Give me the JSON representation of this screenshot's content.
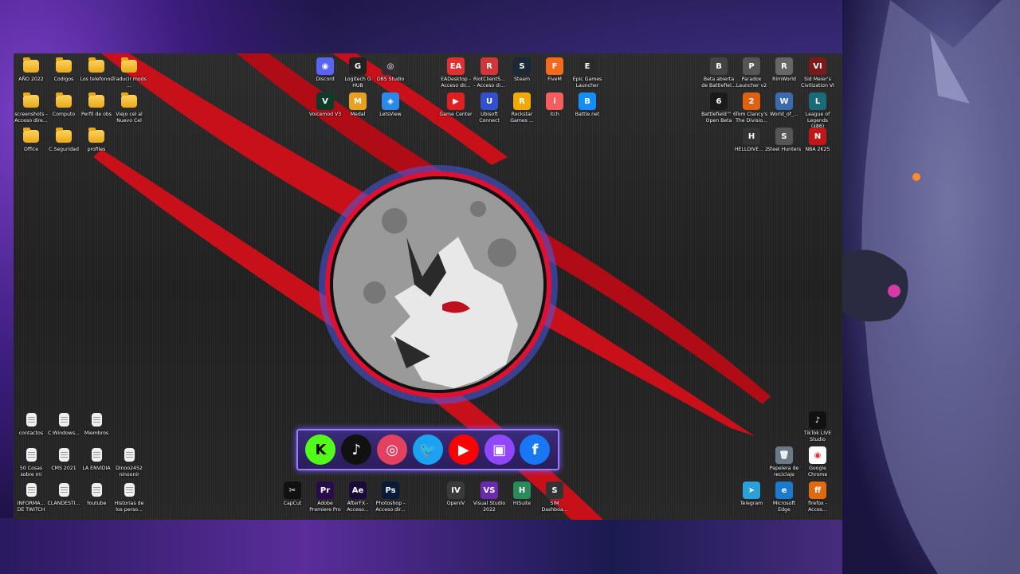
{
  "desktop": {
    "top_left": [
      {
        "label": "AÑO 2022",
        "type": "folder"
      },
      {
        "label": "Codigos",
        "type": "folder"
      },
      {
        "label": "Los telefonos",
        "type": "folder"
      },
      {
        "label": "Traducir mods ...",
        "type": "folder"
      },
      {
        "label": "screenshots - Acceso dire...",
        "type": "folder"
      },
      {
        "label": "Computo",
        "type": "folder"
      },
      {
        "label": "Perfil de obs",
        "type": "folder"
      },
      {
        "label": "Viejo cel al Nuevo Cel",
        "type": "folder"
      },
      {
        "label": "Office",
        "type": "folder"
      },
      {
        "label": "C.Seguridad",
        "type": "folder"
      },
      {
        "label": "profiles",
        "type": "folder"
      }
    ],
    "top_center": [
      {
        "label": "Discord",
        "color": "#5865f2",
        "glyph": "◉"
      },
      {
        "label": "Logitech G HUB",
        "color": "#222222",
        "glyph": "G"
      },
      {
        "label": "OBS Studio",
        "color": "#302e31",
        "glyph": "◎"
      },
      {
        "label": "Voicemod V3",
        "color": "#0d3a2a",
        "glyph": "V"
      },
      {
        "label": "Medal",
        "color": "#e8a020",
        "glyph": "M"
      },
      {
        "label": "LetsView",
        "color": "#2a8ae8",
        "glyph": "◈"
      }
    ],
    "top_right_apps": [
      {
        "label": "EADesktop - Acceso dir...",
        "color": "#e03030",
        "glyph": "EA"
      },
      {
        "label": "RiotClientS... - Acceso di...",
        "color": "#d13639",
        "glyph": "R"
      },
      {
        "label": "Steam",
        "color": "#1b2838",
        "glyph": "S"
      },
      {
        "label": "FiveM",
        "color": "#f26b1d",
        "glyph": "F"
      },
      {
        "label": "Epic Games Launcher",
        "color": "#2a2a2a",
        "glyph": "E"
      },
      {
        "label": "Game Center",
        "color": "#e02020",
        "glyph": "▶"
      },
      {
        "label": "Ubisoft Connect",
        "color": "#3050d0",
        "glyph": "U"
      },
      {
        "label": "Rockstar Games ...",
        "color": "#f2a900",
        "glyph": "R"
      },
      {
        "label": "itch",
        "color": "#fa5c5c",
        "glyph": "i"
      },
      {
        "label": "Battle.net",
        "color": "#148eff",
        "glyph": "B"
      }
    ],
    "top_far_right": [
      {
        "label": "Beta abierta de Battlefiel...",
        "color": "#444444",
        "glyph": "B"
      },
      {
        "label": "Paradox Launcher v2",
        "color": "#555555",
        "glyph": "P"
      },
      {
        "label": "RimWorld",
        "color": "#666666",
        "glyph": "R"
      },
      {
        "label": "Sid Meier's Civilization VI",
        "color": "#7a1a1a",
        "glyph": "VI"
      },
      {
        "label": "Battlefield™ 6 Open Beta",
        "color": "#1a1a1a",
        "glyph": "6"
      },
      {
        "label": "Tom Clancy's The Divisio...",
        "color": "#e06010",
        "glyph": "2"
      },
      {
        "label": "World_of_...",
        "color": "#3a6ab0",
        "glyph": "W"
      },
      {
        "label": "League of Legends (x86)",
        "color": "#1a6a7a",
        "glyph": "L"
      },
      {
        "label": "HELLDIVE... 2",
        "color": "#333333",
        "glyph": "H"
      },
      {
        "label": "Steel Hunters",
        "color": "#555555",
        "glyph": "S"
      },
      {
        "label": "NBA 2K25",
        "color": "#c01818",
        "glyph": "N"
      }
    ],
    "bottom_left": [
      {
        "label": "contactos",
        "type": "doc"
      },
      {
        "label": "C:Windows...",
        "type": "doc"
      },
      {
        "label": "Miembros",
        "type": "doc"
      },
      {
        "label": "50 Cosas sobre mi",
        "type": "doc"
      },
      {
        "label": "CMS 2021",
        "type": "doc"
      },
      {
        "label": "LA ENVIDIA",
        "type": "doc"
      },
      {
        "label": "Dinoo2452 ninoonir",
        "type": "doc"
      },
      {
        "label": "INFORMA... DE TWITCH",
        "type": "doc"
      },
      {
        "label": "CLANDESTI...",
        "type": "doc"
      },
      {
        "label": "Youtube",
        "type": "doc"
      },
      {
        "label": "Historias de los perso...",
        "type": "doc"
      }
    ],
    "bottom_center": [
      {
        "label": "CapCut",
        "color": "#111111",
        "glyph": "✂"
      },
      {
        "label": "Adobe Premiere Pro",
        "color": "#2a0a4a",
        "glyph": "Pr"
      },
      {
        "label": "AfterFX - Acceso...",
        "color": "#1a0a3a",
        "glyph": "Ae"
      },
      {
        "label": "Photoshop - Acceso dir...",
        "color": "#0a1a3a",
        "glyph": "Ps"
      },
      {
        "label": "OpenIV",
        "color": "#3a3a3a",
        "glyph": "IV"
      },
      {
        "label": "Visual Studio 2022",
        "color": "#6a2ab0",
        "glyph": "VS"
      },
      {
        "label": "HiSuite",
        "color": "#2a8a5a",
        "glyph": "H"
      },
      {
        "label": "SIM Dashboa...",
        "color": "#333333",
        "glyph": "S"
      }
    ],
    "bottom_right": [
      {
        "label": "TikTok LIVE Studio",
        "color": "#111111",
        "glyph": "♪"
      },
      {
        "label": "Papelera de reciclaje",
        "color": "#6a7a8a",
        "glyph": "🗑"
      },
      {
        "label": "Google Chrome",
        "color": "#ffffff",
        "glyph": "◉"
      },
      {
        "label": "Telegram",
        "color": "#2aa1da",
        "glyph": "➤"
      },
      {
        "label": "Microsoft Edge",
        "color": "#1a7ad0",
        "glyph": "e"
      },
      {
        "label": "firefox - Acces...",
        "color": "#e06a10",
        "glyph": "ff"
      }
    ]
  },
  "social": [
    {
      "name": "kick-icon",
      "glyph": "K",
      "bg": "#53fc18",
      "fg": "#000000"
    },
    {
      "name": "tiktok-icon",
      "glyph": "♪",
      "bg": "#111111",
      "fg": "#ffffff"
    },
    {
      "name": "instagram-icon",
      "glyph": "◎",
      "bg": "#e4405f",
      "fg": "#ffffff"
    },
    {
      "name": "twitter-icon",
      "glyph": "🐦",
      "bg": "#1da1f2",
      "fg": "#ffffff"
    },
    {
      "name": "youtube-icon",
      "glyph": "▶",
      "bg": "#ff0000",
      "fg": "#ffffff"
    },
    {
      "name": "twitch-icon",
      "glyph": "▣",
      "bg": "#9146ff",
      "fg": "#ffffff"
    },
    {
      "name": "facebook-icon",
      "glyph": "f",
      "bg": "#1877f2",
      "fg": "#ffffff"
    }
  ],
  "colors": {
    "claw": "#c8101a",
    "ring_inner": "#e01030",
    "ring_outer": "#5a6aff"
  }
}
